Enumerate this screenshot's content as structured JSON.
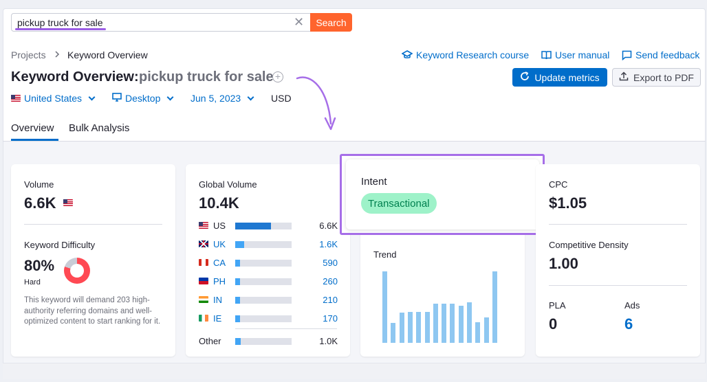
{
  "search": {
    "value": "pickup truck for sale",
    "button": "Search"
  },
  "breadcrumb": {
    "root": "Projects",
    "separator": ">",
    "current": "Keyword Overview"
  },
  "links": {
    "course": "Keyword Research course",
    "manual": "User manual",
    "feedback": "Send feedback"
  },
  "header": {
    "title": "Keyword Overview:",
    "keyword": "pickup truck for sale",
    "update_button": "Update metrics",
    "export_button": "Export to PDF"
  },
  "filters": {
    "country": "United States",
    "device": "Desktop",
    "date": "Jun 5, 2023",
    "currency": "USD"
  },
  "tabs": [
    "Overview",
    "Bulk Analysis"
  ],
  "volume": {
    "label": "Volume",
    "value": "6.6K"
  },
  "difficulty": {
    "label": "Keyword Difficulty",
    "value": "80%",
    "level": "Hard",
    "percent": 80,
    "description": "This keyword will demand 203 high-authority referring domains and well-optimized content to start ranking for it."
  },
  "global_volume": {
    "label": "Global Volume",
    "value": "10.4K",
    "rows": [
      {
        "code": "US",
        "value": "6.6K",
        "share": 0.64,
        "flag": "us"
      },
      {
        "code": "UK",
        "value": "1.6K",
        "share": 0.16,
        "flag": "gb"
      },
      {
        "code": "CA",
        "value": "590",
        "share": 0.06,
        "flag": "ca"
      },
      {
        "code": "PH",
        "value": "260",
        "share": 0.03,
        "flag": "ph"
      },
      {
        "code": "IN",
        "value": "210",
        "share": 0.02,
        "flag": "in"
      },
      {
        "code": "IE",
        "value": "170",
        "share": 0.02,
        "flag": "ie"
      }
    ],
    "other": {
      "code": "Other",
      "value": "1.0K",
      "share": 0.1
    }
  },
  "intent": {
    "label": "Intent",
    "value": "Transactional"
  },
  "trend": {
    "label": "Trend",
    "values": [
      1.0,
      0.28,
      0.42,
      0.43,
      0.43,
      0.43,
      0.55,
      0.55,
      0.55,
      0.52,
      0.57,
      0.29,
      0.36,
      1.0
    ]
  },
  "cpc": {
    "label": "CPC",
    "value": "$1.05"
  },
  "competitive_density": {
    "label": "Competitive Density",
    "value": "1.00"
  },
  "pla": {
    "label": "PLA",
    "value": "0"
  },
  "ads": {
    "label": "Ads",
    "value": "6"
  },
  "colors": {
    "accent": "#006dca",
    "search_button": "#ff642d",
    "highlight": "#a66ee8",
    "intent_badge": "#9ef2c9",
    "difficulty": "#ff4953",
    "trend_bar": "#8ec7f1"
  }
}
